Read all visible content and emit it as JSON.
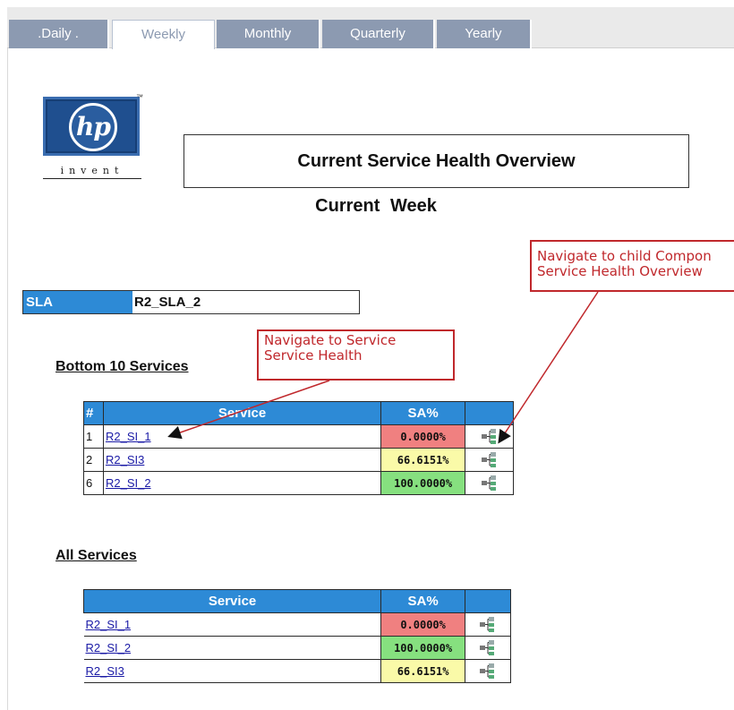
{
  "tabs": [
    {
      "label": ".Daily ."
    },
    {
      "label": "Weekly"
    },
    {
      "label": "Monthly"
    },
    {
      "label": "Quarterly"
    },
    {
      "label": "Yearly"
    }
  ],
  "active_tab": "Weekly",
  "logo": {
    "text": "hp",
    "tagline": "invent",
    "mark": "™"
  },
  "title": "Current Service Health Overview",
  "subtitle": "Current Week",
  "sla": {
    "label": "SLA",
    "value": "R2_SLA_2"
  },
  "bottom_section": {
    "heading": "Bottom 10 Services",
    "headers": {
      "num": "#",
      "service": "Service",
      "sa": "SA%"
    },
    "rows": [
      {
        "num": "1",
        "service": "R2_SI_1",
        "sa": "0.0000%",
        "status": "red"
      },
      {
        "num": "2",
        "service": "R2_SI3",
        "sa": "66.6151%",
        "status": "yellow"
      },
      {
        "num": "6",
        "service": "R2_SI_2",
        "sa": "100.0000%",
        "status": "green"
      }
    ]
  },
  "all_section": {
    "heading": "All Services",
    "headers": {
      "service": "Service",
      "sa": "SA%"
    },
    "rows": [
      {
        "service": "R2_SI_1",
        "sa": "0.0000%",
        "status": "red"
      },
      {
        "service": "R2_SI_2",
        "sa": "100.0000%",
        "status": "green"
      },
      {
        "service": "R2_SI3",
        "sa": "66.6151%",
        "status": "yellow"
      }
    ]
  },
  "callouts": {
    "service": {
      "line1": "Navigate to Service",
      "line2": "Service Health"
    },
    "child": {
      "line1": "Navigate to child Compon",
      "line2": "Service Health Overview"
    }
  },
  "colors": {
    "header_blue": "#2d8ad6",
    "tab_blue": "#8c9ab1",
    "red": "#f08080",
    "yellow": "#fafaa8",
    "green": "#86e07f",
    "callout_red": "#c0282c"
  },
  "icons": {
    "row_action": "component-tree-icon"
  }
}
